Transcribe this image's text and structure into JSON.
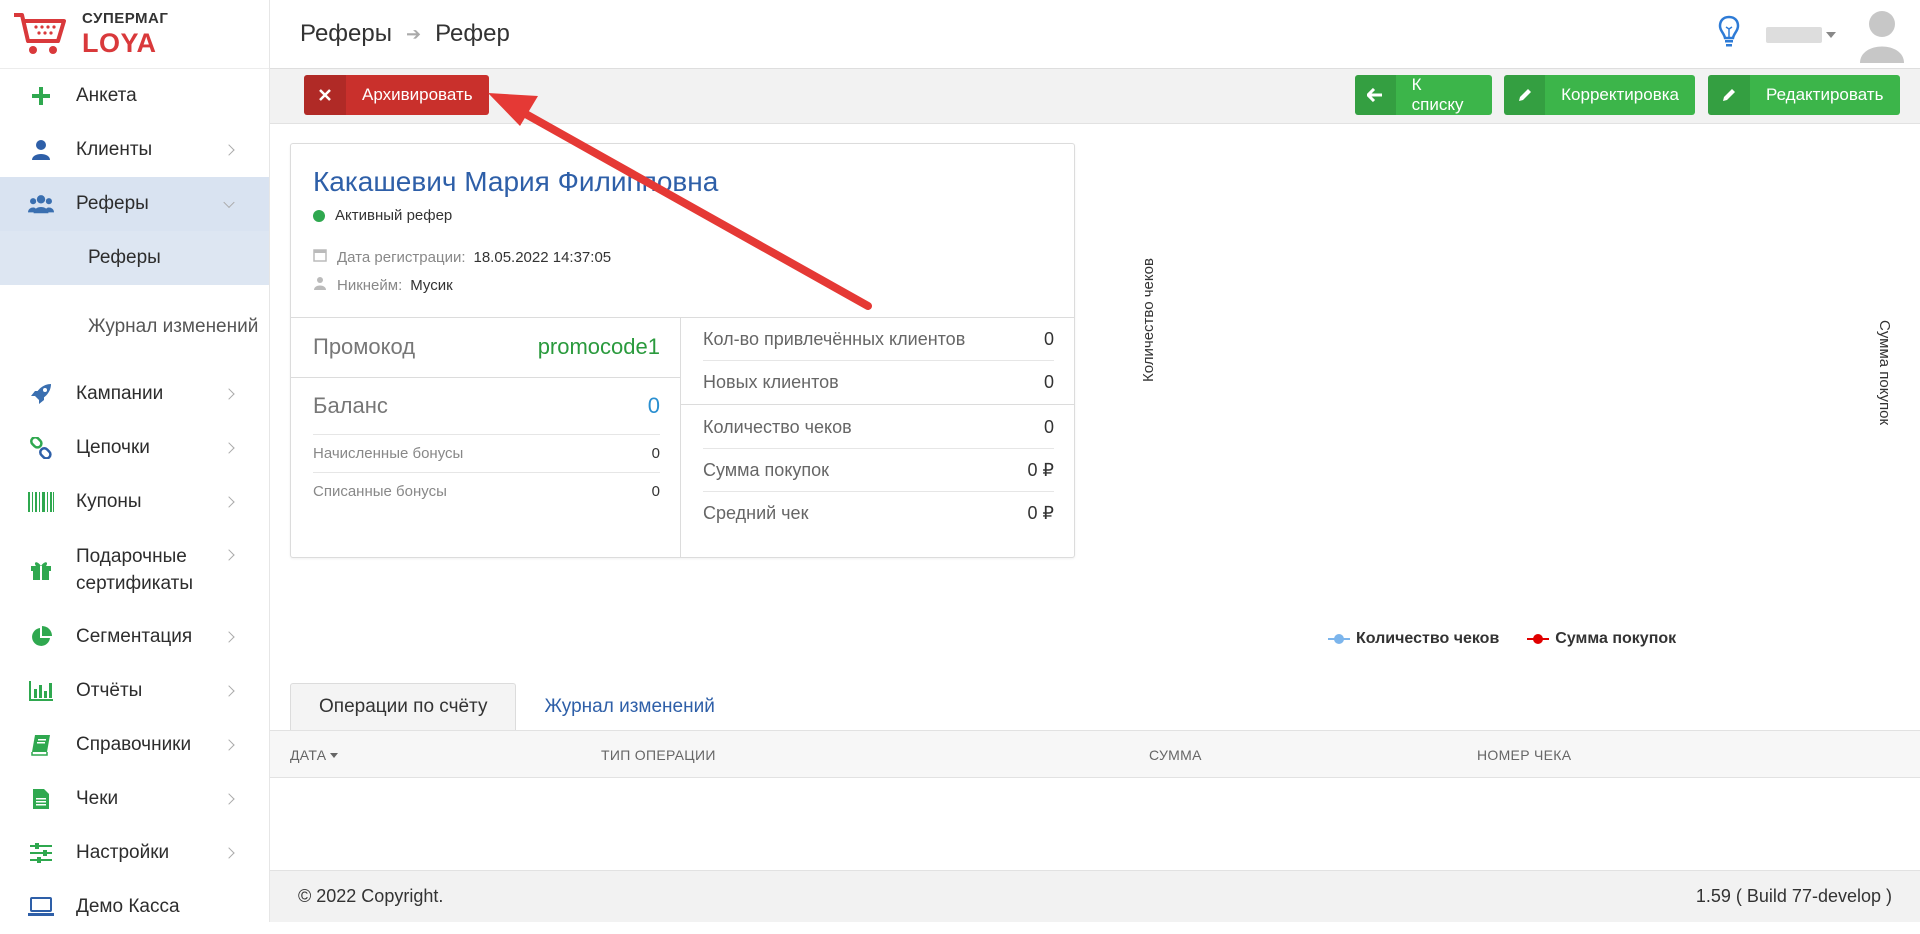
{
  "brand": {
    "line1": "СУПЕРМАГ",
    "line2": "LOYA",
    "color": "#d9393b"
  },
  "sidebar": {
    "items": [
      {
        "label": "Анкета",
        "icon": "plus-icon"
      },
      {
        "label": "Клиенты",
        "icon": "user-icon"
      },
      {
        "label": "Реферы",
        "icon": "users-icon",
        "active": true,
        "expanded": true
      },
      {
        "label": "Кампании",
        "icon": "rocket-icon"
      },
      {
        "label": "Цепочки",
        "icon": "link-icon"
      },
      {
        "label": "Купоны",
        "icon": "barcode-icon"
      },
      {
        "label": "Подарочные сертификаты",
        "icon": "gift-icon"
      },
      {
        "label": "Сегментация",
        "icon": "pie-icon"
      },
      {
        "label": "Отчёты",
        "icon": "bar-chart-icon"
      },
      {
        "label": "Справочники",
        "icon": "book-icon"
      },
      {
        "label": "Чеки",
        "icon": "file-icon"
      },
      {
        "label": "Настройки",
        "icon": "sliders-icon"
      },
      {
        "label": "Демо Касса",
        "icon": "laptop-icon"
      }
    ],
    "subitems": [
      {
        "label": "Реферы",
        "active": true
      },
      {
        "label": "Журнал изменений"
      }
    ]
  },
  "header": {
    "breadcrumb": [
      "Реферы",
      "Рефер"
    ]
  },
  "actions": {
    "archive": "Архивировать",
    "to_list": "К списку",
    "correction": "Корректировка",
    "edit": "Редактировать"
  },
  "referer": {
    "name": "Какашевич Мария Филипповна",
    "status": "Активный рефер",
    "reg_label": "Дата регистрации:",
    "reg_value": "18.05.2022 14:37:05",
    "nick_label": "Никнейм:",
    "nick_value": "Мусик",
    "promo_label": "Промокод",
    "promo_value": "promocode1",
    "balance_label": "Баланс",
    "balance_value": "0",
    "accrued_label": "Начисленные бонусы",
    "accrued_value": "0",
    "spent_label": "Списанные бонусы",
    "spent_value": "0",
    "stats": [
      {
        "label": "Кол-во привлечённых клиентов",
        "value": "0"
      },
      {
        "label": "Новых клиентов",
        "value": "0"
      },
      {
        "label": "Количество чеков",
        "value": "0"
      },
      {
        "label": "Сумма покупок",
        "value": "0 ₽"
      },
      {
        "label": "Средний чек",
        "value": "0 ₽"
      }
    ]
  },
  "chart_data": {
    "type": "line",
    "ylabel": "Количество чеков",
    "y2label": "Сумма покупок",
    "series": [
      {
        "name": "Количество чеков",
        "color": "#7cb5ec",
        "values": []
      },
      {
        "name": "Сумма покупок",
        "color": "#e00000",
        "values": []
      }
    ]
  },
  "tabs": [
    {
      "label": "Операции по счёту",
      "active": true
    },
    {
      "label": "Журнал изменений"
    }
  ],
  "table": {
    "columns": [
      "ДАТА",
      "ТИП ОПЕРАЦИИ",
      "СУММА",
      "НОМЕР ЧЕКА"
    ]
  },
  "footer": {
    "copyright": "© 2022 Copyright.",
    "version": "1.59 ( Build 77-develop )"
  },
  "colors": {
    "accent_blue": "#2e5fa8",
    "danger": "#c9302c",
    "success": "#3cb54a",
    "promo_green": "#2a9a3d"
  }
}
